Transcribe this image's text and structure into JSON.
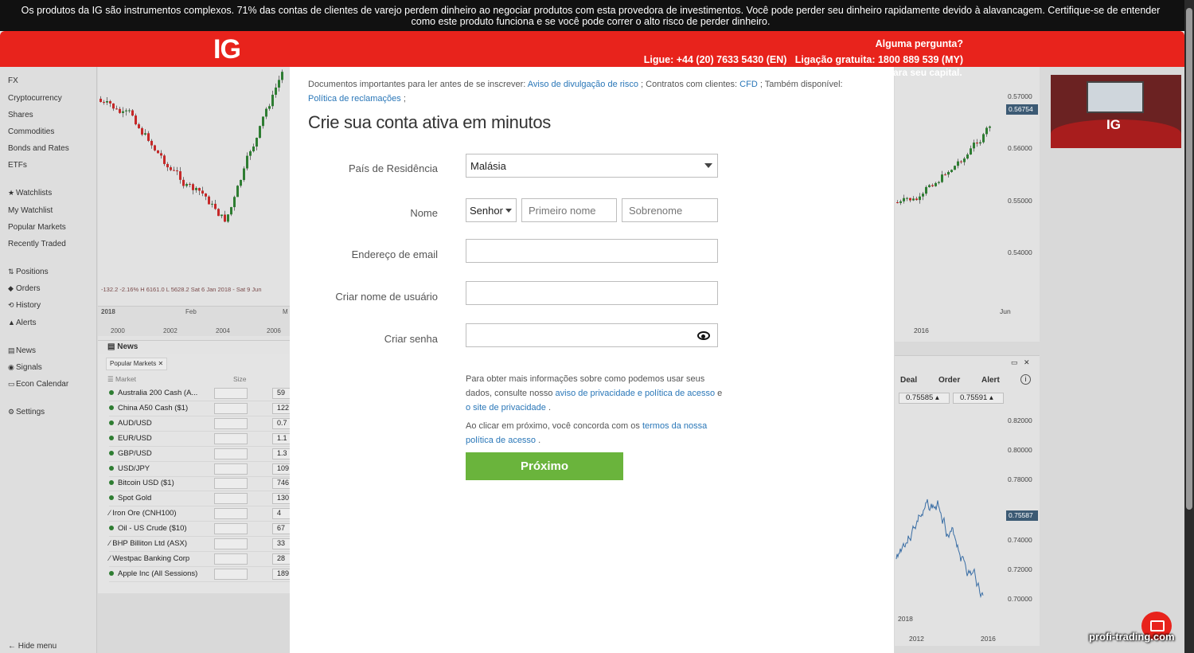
{
  "risk_banner": {
    "line1": "Os produtos da IG são instrumentos complexos. 71% das contas de clientes de varejo perdem dinheiro ao negociar produtos com esta provedora de investimentos. Você pode perder seu dinheiro rapidamente devido à alavancagem. Certifique-se de entender",
    "line2": "como este produto funciona e se você pode correr o alto risco de perder dinheiro."
  },
  "header": {
    "logo": "IG",
    "question": "Alguma pergunta?",
    "phone": "Ligue: +44 (20) 7633 5430 (EN)   Ligação gratuita: 1800 889 539 (MY)"
  },
  "platform": {
    "sidebar": [
      {
        "label": "FX",
        "icon": ""
      },
      {
        "label": "Cryptocurrency",
        "icon": ""
      },
      {
        "label": "Shares",
        "icon": ""
      },
      {
        "label": "Commodities",
        "icon": ""
      },
      {
        "label": "Bonds and Rates",
        "icon": ""
      },
      {
        "label": "ETFs",
        "icon": ""
      },
      {
        "label": "Watchlists",
        "icon": "★"
      },
      {
        "label": "My Watchlist",
        "icon": ""
      },
      {
        "label": "Popular Markets",
        "icon": ""
      },
      {
        "label": "Recently Traded",
        "icon": ""
      },
      {
        "label": "Positions",
        "icon": "⇅"
      },
      {
        "label": "Orders",
        "icon": "◆"
      },
      {
        "label": "History",
        "icon": "⟲"
      },
      {
        "label": "Alerts",
        "icon": "▲"
      },
      {
        "label": "News",
        "icon": "▤"
      },
      {
        "label": "Signals",
        "icon": "◉"
      },
      {
        "label": "Econ Calendar",
        "icon": "▭"
      },
      {
        "label": "Settings",
        "icon": "⚙"
      }
    ],
    "hide_menu": "← Hide menu",
    "stats": "-132.2   -2.16%   H 6161.0   L 5628.2   Sat 6 Jan 2018 - Sat 9 Jun",
    "year_labels": [
      "2018",
      "Feb",
      "M"
    ],
    "mini_years": [
      "2000",
      "2002",
      "2004",
      "2006"
    ],
    "news_label": "News",
    "markets_tab": "Popular Markets",
    "market_col": "Market",
    "size_col": "Size",
    "markets": [
      {
        "name": "Australia 200 Cash (A...",
        "val": "59",
        "type": "dot"
      },
      {
        "name": "China A50 Cash ($1)",
        "val": "122",
        "type": "dot"
      },
      {
        "name": "AUD/USD",
        "val": "0.7",
        "type": "dot"
      },
      {
        "name": "EUR/USD",
        "val": "1.1",
        "type": "dot"
      },
      {
        "name": "GBP/USD",
        "val": "1.3",
        "type": "dot"
      },
      {
        "name": "USD/JPY",
        "val": "109",
        "type": "dot"
      },
      {
        "name": "Bitcoin USD ($1)",
        "val": "746",
        "type": "dot"
      },
      {
        "name": "Spot Gold",
        "val": "130",
        "type": "dot"
      },
      {
        "name": "Iron Ore (CNH100)",
        "val": "4",
        "type": "slash"
      },
      {
        "name": "Oil - US Crude ($10)",
        "val": "67",
        "type": "dot"
      },
      {
        "name": "BHP Billiton Ltd (ASX)",
        "val": "33",
        "type": "slash"
      },
      {
        "name": "Westpac Banking Corp",
        "val": "28",
        "type": "slash"
      },
      {
        "name": "Apple Inc (All Sessions)",
        "val": "189",
        "type": "dot"
      }
    ],
    "right_axis": [
      "0.57000",
      "0.56000",
      "0.55000",
      "0.54000"
    ],
    "right_price": "0.56754",
    "capital_text": "ara seu capital.",
    "right_axis2": [
      "0.82000",
      "0.80000",
      "0.78000",
      "0.74000",
      "0.72000",
      "0.70000"
    ],
    "right_price2": "0.75587",
    "deal_headers": [
      "Deal",
      "Order",
      "Alert"
    ],
    "deal_values": [
      "0.75585 ▴",
      "0.75591 ▴"
    ],
    "right_years": [
      "2016",
      "2018",
      "2012",
      "2016",
      "Jun"
    ],
    "video_logo": "IG"
  },
  "modal": {
    "docs_prefix": "Documentos importantes para ler antes de se inscrever:",
    "docs_link1": "Aviso de divulgação de risco",
    "docs_mid": "; Contratos com clientes:",
    "docs_link2": "CFD",
    "docs_mid2": "; Também disponível:",
    "docs_link3": "Política de reclamações",
    "docs_end": ";",
    "title": "Crie sua conta ativa em minutos",
    "country_label": "País de Residência",
    "country_value": "Malásia",
    "name_label": "Nome",
    "salutation": "Senhor",
    "first_name_placeholder": "Primeiro nome",
    "last_name_placeholder": "Sobrenome",
    "email_label": "Endereço de email",
    "username_label": "Criar nome de usuário",
    "password_label": "Criar senha",
    "info1_text": "Para obter mais informações sobre como podemos usar seus dados, consulte nosso",
    "info1_link": "aviso de privacidade e política de acesso",
    "info1_mid": "e",
    "info1_link2": "o site de privacidade",
    "info1_end": ".",
    "info2_text": "Ao clicar em próximo, você concorda com os",
    "info2_link": "termos da nossa política de acesso",
    "info2_end": ".",
    "next_button": "Próximo"
  },
  "watermark": "profi-trading.com",
  "colors": {
    "brand_red": "#e8231c",
    "next_green": "#6ab43c",
    "link_blue": "#2a77b8"
  }
}
